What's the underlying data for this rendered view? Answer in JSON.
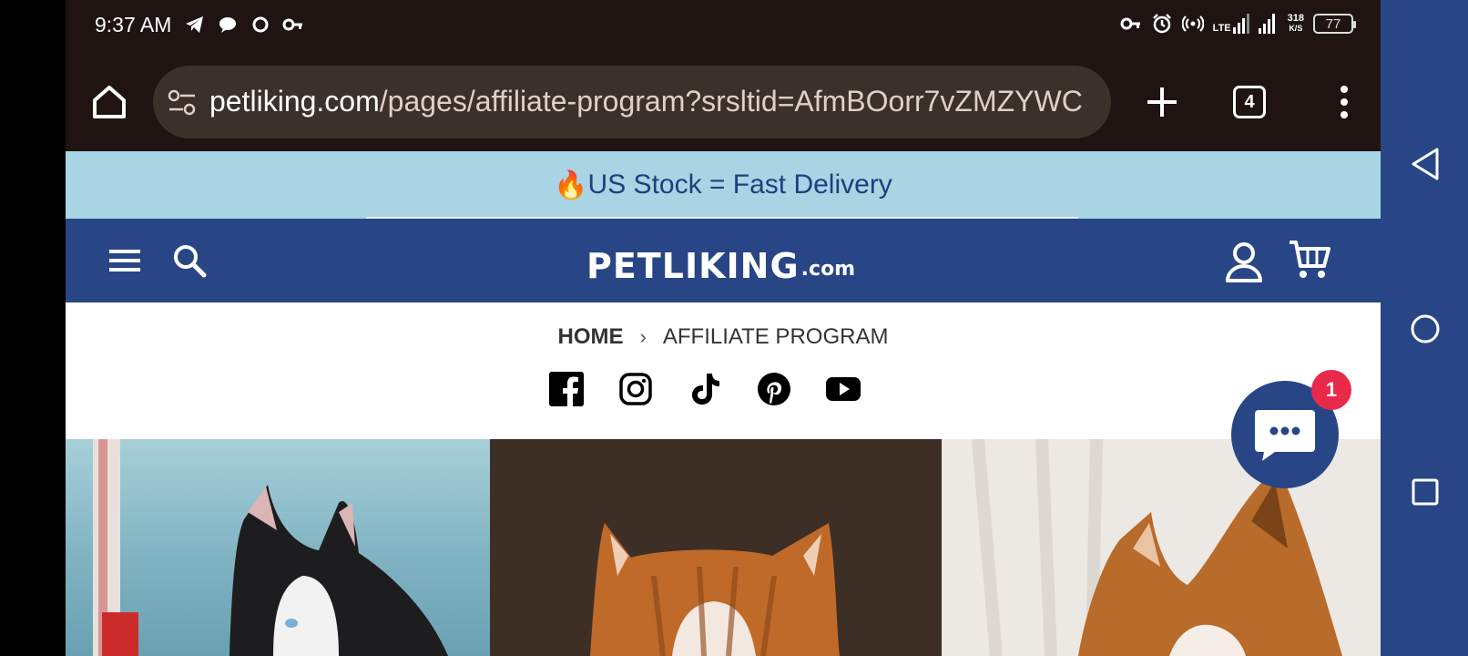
{
  "status_bar": {
    "time": "9:37 AM",
    "network_type": "LTE",
    "speed_value": "318",
    "speed_unit": "K/S",
    "battery": "77",
    "left_icons": [
      "telegram-icon",
      "chat-bubble-icon",
      "sync-icon",
      "key-icon"
    ],
    "right_icons": [
      "vpn-key-icon",
      "alarm-icon",
      "hotspot-icon",
      "signal-icon"
    ]
  },
  "browser": {
    "url_domain": "petliking.com",
    "url_path": "/pages/affiliate-program?srsltid=AfmBOorr7vZMZYWC",
    "tab_count": "4"
  },
  "announcement": {
    "emoji": "🔥",
    "text": "US Stock = Fast Delivery"
  },
  "header": {
    "logo_main": "PETLIKING",
    "logo_suffix": ".com"
  },
  "breadcrumb": {
    "home": "HOME",
    "separator": "›",
    "current": "AFFILIATE PROGRAM"
  },
  "socials": [
    "facebook-icon",
    "instagram-icon",
    "tiktok-icon",
    "pinterest-icon",
    "youtube-icon"
  ],
  "chat": {
    "badge_count": "1"
  },
  "colors": {
    "brand_blue": "#284686",
    "announcement_bg": "#a8d4e4",
    "badge_red": "#e8294a",
    "browser_bg": "#1f1411"
  }
}
